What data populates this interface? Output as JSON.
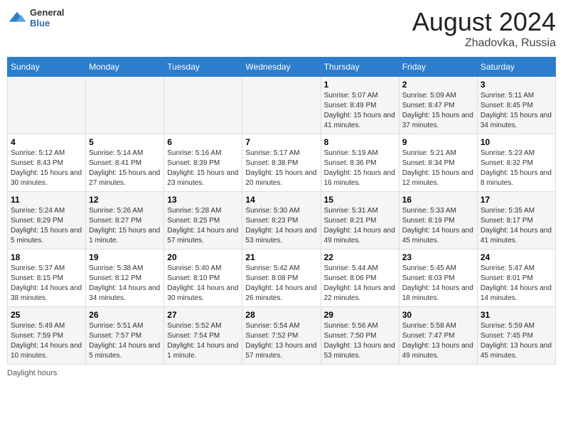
{
  "header": {
    "logo_general": "General",
    "logo_blue": "Blue",
    "month_year": "August 2024",
    "location": "Zhadovka, Russia"
  },
  "footer": {
    "daylight_label": "Daylight hours"
  },
  "weekdays": [
    "Sunday",
    "Monday",
    "Tuesday",
    "Wednesday",
    "Thursday",
    "Friday",
    "Saturday"
  ],
  "weeks": [
    [
      {
        "day": "",
        "info": ""
      },
      {
        "day": "",
        "info": ""
      },
      {
        "day": "",
        "info": ""
      },
      {
        "day": "",
        "info": ""
      },
      {
        "day": "1",
        "info": "Sunrise: 5:07 AM\nSunset: 8:49 PM\nDaylight: 15 hours and 41 minutes."
      },
      {
        "day": "2",
        "info": "Sunrise: 5:09 AM\nSunset: 8:47 PM\nDaylight: 15 hours and 37 minutes."
      },
      {
        "day": "3",
        "info": "Sunrise: 5:11 AM\nSunset: 8:45 PM\nDaylight: 15 hours and 34 minutes."
      }
    ],
    [
      {
        "day": "4",
        "info": "Sunrise: 5:12 AM\nSunset: 8:43 PM\nDaylight: 15 hours and 30 minutes."
      },
      {
        "day": "5",
        "info": "Sunrise: 5:14 AM\nSunset: 8:41 PM\nDaylight: 15 hours and 27 minutes."
      },
      {
        "day": "6",
        "info": "Sunrise: 5:16 AM\nSunset: 8:39 PM\nDaylight: 15 hours and 23 minutes."
      },
      {
        "day": "7",
        "info": "Sunrise: 5:17 AM\nSunset: 8:38 PM\nDaylight: 15 hours and 20 minutes."
      },
      {
        "day": "8",
        "info": "Sunrise: 5:19 AM\nSunset: 8:36 PM\nDaylight: 15 hours and 16 minutes."
      },
      {
        "day": "9",
        "info": "Sunrise: 5:21 AM\nSunset: 8:34 PM\nDaylight: 15 hours and 12 minutes."
      },
      {
        "day": "10",
        "info": "Sunrise: 5:23 AM\nSunset: 8:32 PM\nDaylight: 15 hours and 8 minutes."
      }
    ],
    [
      {
        "day": "11",
        "info": "Sunrise: 5:24 AM\nSunset: 8:29 PM\nDaylight: 15 hours and 5 minutes."
      },
      {
        "day": "12",
        "info": "Sunrise: 5:26 AM\nSunset: 8:27 PM\nDaylight: 15 hours and 1 minute."
      },
      {
        "day": "13",
        "info": "Sunrise: 5:28 AM\nSunset: 8:25 PM\nDaylight: 14 hours and 57 minutes."
      },
      {
        "day": "14",
        "info": "Sunrise: 5:30 AM\nSunset: 8:23 PM\nDaylight: 14 hours and 53 minutes."
      },
      {
        "day": "15",
        "info": "Sunrise: 5:31 AM\nSunset: 8:21 PM\nDaylight: 14 hours and 49 minutes."
      },
      {
        "day": "16",
        "info": "Sunrise: 5:33 AM\nSunset: 8:19 PM\nDaylight: 14 hours and 45 minutes."
      },
      {
        "day": "17",
        "info": "Sunrise: 5:35 AM\nSunset: 8:17 PM\nDaylight: 14 hours and 41 minutes."
      }
    ],
    [
      {
        "day": "18",
        "info": "Sunrise: 5:37 AM\nSunset: 8:15 PM\nDaylight: 14 hours and 38 minutes."
      },
      {
        "day": "19",
        "info": "Sunrise: 5:38 AM\nSunset: 8:12 PM\nDaylight: 14 hours and 34 minutes."
      },
      {
        "day": "20",
        "info": "Sunrise: 5:40 AM\nSunset: 8:10 PM\nDaylight: 14 hours and 30 minutes."
      },
      {
        "day": "21",
        "info": "Sunrise: 5:42 AM\nSunset: 8:08 PM\nDaylight: 14 hours and 26 minutes."
      },
      {
        "day": "22",
        "info": "Sunrise: 5:44 AM\nSunset: 8:06 PM\nDaylight: 14 hours and 22 minutes."
      },
      {
        "day": "23",
        "info": "Sunrise: 5:45 AM\nSunset: 8:03 PM\nDaylight: 14 hours and 18 minutes."
      },
      {
        "day": "24",
        "info": "Sunrise: 5:47 AM\nSunset: 8:01 PM\nDaylight: 14 hours and 14 minutes."
      }
    ],
    [
      {
        "day": "25",
        "info": "Sunrise: 5:49 AM\nSunset: 7:59 PM\nDaylight: 14 hours and 10 minutes."
      },
      {
        "day": "26",
        "info": "Sunrise: 5:51 AM\nSunset: 7:57 PM\nDaylight: 14 hours and 5 minutes."
      },
      {
        "day": "27",
        "info": "Sunrise: 5:52 AM\nSunset: 7:54 PM\nDaylight: 14 hours and 1 minute."
      },
      {
        "day": "28",
        "info": "Sunrise: 5:54 AM\nSunset: 7:52 PM\nDaylight: 13 hours and 57 minutes."
      },
      {
        "day": "29",
        "info": "Sunrise: 5:56 AM\nSunset: 7:50 PM\nDaylight: 13 hours and 53 minutes."
      },
      {
        "day": "30",
        "info": "Sunrise: 5:58 AM\nSunset: 7:47 PM\nDaylight: 13 hours and 49 minutes."
      },
      {
        "day": "31",
        "info": "Sunrise: 5:59 AM\nSunset: 7:45 PM\nDaylight: 13 hours and 45 minutes."
      }
    ]
  ]
}
